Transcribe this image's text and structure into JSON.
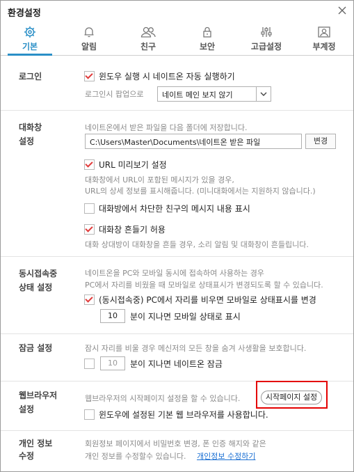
{
  "window": {
    "title": "환경설정"
  },
  "tabs": [
    {
      "label": "기본",
      "icon": "gear-icon",
      "active": true
    },
    {
      "label": "알림",
      "icon": "bell-icon"
    },
    {
      "label": "친구",
      "icon": "friends-icon"
    },
    {
      "label": "보안",
      "icon": "lock-icon"
    },
    {
      "label": "고급설정",
      "icon": "sliders-icon"
    },
    {
      "label": "부계정",
      "icon": "sub-account-icon"
    }
  ],
  "login": {
    "title": "로그인",
    "autorun_label": "윈도우 실행 시 네이트온 자동 실행하기",
    "autorun_checked": true,
    "popup_label": "로그인시 팝업으로",
    "popup_select": "네이트 메인 보지 않기"
  },
  "chat": {
    "title_line1": "대화창",
    "title_line2": "설정",
    "save_desc": "네이트온에서 받은 파일을 다음 폴더에 저장합니다.",
    "folder_path": "C:\\Users\\Master\\Documents\\네이트온 받은 파일",
    "change_button": "변경",
    "url_preview_label": "URL 미리보기 설정",
    "url_preview_checked": true,
    "url_desc1": "대화창에서 URL이 포함된 메시지가 있을 경우,",
    "url_desc2": "URL의 상세 정보를 표시해줍니다. (미니대화에서는 지원하지 않습니다.)",
    "blocked_label": "대화방에서 차단한 친구의 메시지 내용 표시",
    "blocked_checked": false,
    "shake_label": "대화창 흔들기 허용",
    "shake_checked": true,
    "shake_desc": "대화 상대방이 대화창을 흔들 경우, 소리 알림 및 대화창이 흔들립니다."
  },
  "concurrent": {
    "title_line1": "동시접속중",
    "title_line2": "상태 설정",
    "desc1": "네이트온을 PC와 모바일 동시에 접속하여 사용하는 경우",
    "desc2": "PC에서 자리를 비웠을 때 모바일로 상태표시가 변경되도록 할 수 있습니다.",
    "option_label": "(동시접속중) PC에서 자리를 비우면 모바일로 상태표시를 변경",
    "option_checked": true,
    "minutes": "10",
    "minutes_suffix": "분이 지나면 모바일 상태로 표시"
  },
  "lock": {
    "title": "잠금 설정",
    "desc": "잠시 자리를 비울 경우 메신저의 모든 창을 숨겨 사생활을 보호합니다.",
    "checked": false,
    "minutes": "10",
    "minutes_suffix": "분이 지나면 네이트온 잠금"
  },
  "browser": {
    "title_line1": "웹브라우저",
    "title_line2": "설정",
    "desc": "웹브라우저의 시작페이지 설정을 할 수 있습니다.",
    "start_page_button": "시작페이지 설정",
    "default_label": "윈도우에 설정된 기본 웹 브라우저를 사용합니다.",
    "default_checked": false
  },
  "privacy": {
    "title_line1": "개인 정보",
    "title_line2": "수정",
    "desc1": "회원정보 페이지에서 비밀번호 변경, 폰 인증 해지와 같은",
    "desc2": "개인 정보를 수정할수 있습니다.",
    "link": "개인정보 수정하기"
  },
  "colors": {
    "accent": "#2a8fc7",
    "check": "#e03b3b",
    "highlight": "#e40000",
    "link": "#1a6fd3"
  }
}
